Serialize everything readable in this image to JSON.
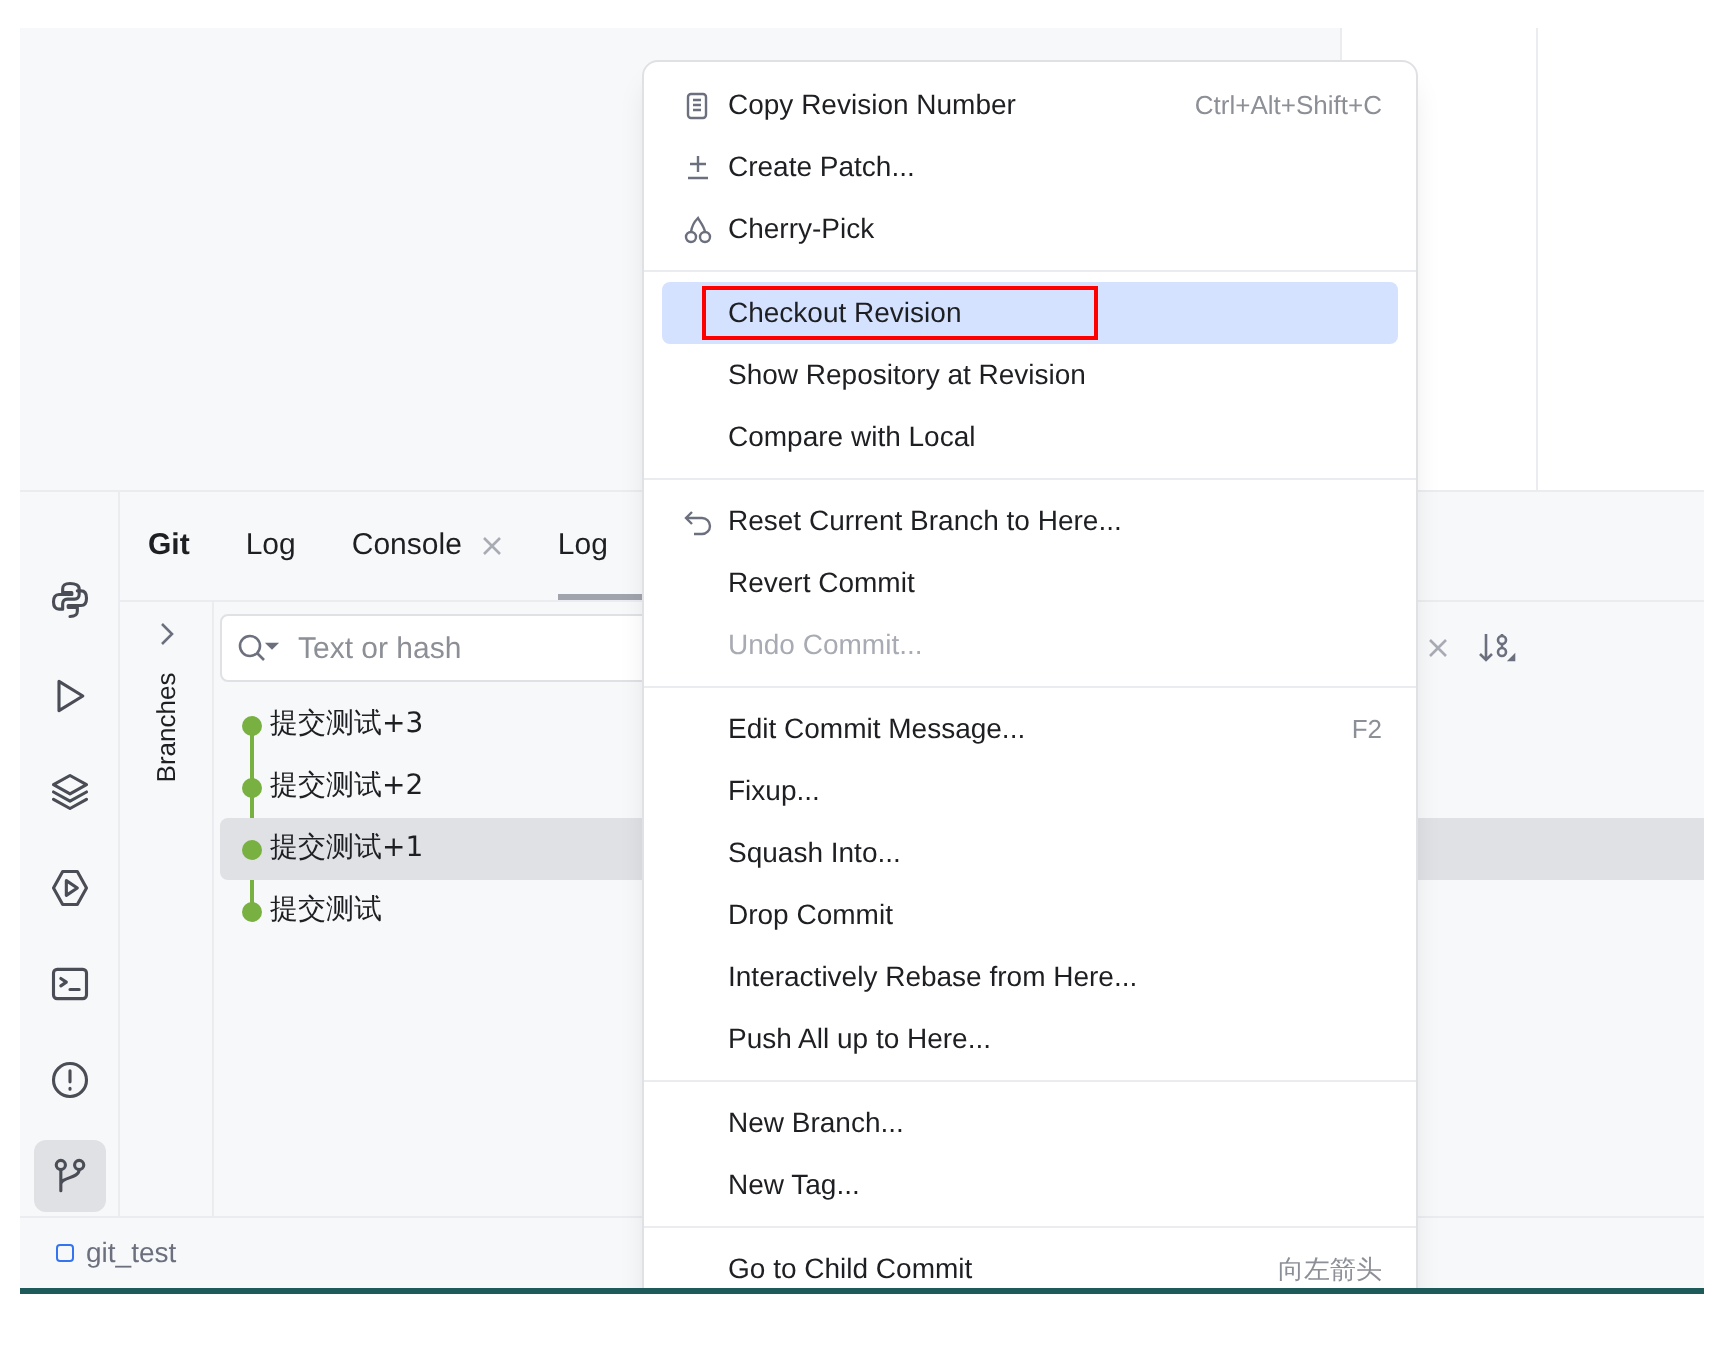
{
  "tool_windows": [
    {
      "kind": "python",
      "selected": false
    },
    {
      "kind": "run",
      "selected": false
    },
    {
      "kind": "layers",
      "selected": false
    },
    {
      "kind": "services",
      "selected": false
    },
    {
      "kind": "terminal",
      "selected": false
    },
    {
      "kind": "problems",
      "selected": false
    },
    {
      "kind": "git",
      "selected": true
    }
  ],
  "panel": {
    "title": "Git",
    "tabs": [
      {
        "label": "Log",
        "selected": false,
        "closable": false
      },
      {
        "label": "Console",
        "selected": false,
        "closable": true
      },
      {
        "label": "Log",
        "selected": true,
        "closable": false
      }
    ]
  },
  "branches_label": "Branches",
  "search": {
    "placeholder": "Text or hash"
  },
  "commits": [
    {
      "message": "提交测试+3",
      "selected": false
    },
    {
      "message": "提交测试+2",
      "selected": false
    },
    {
      "message": "提交测试+1",
      "selected": true
    },
    {
      "message": "提交测试",
      "selected": false
    }
  ],
  "status_bar": {
    "project": "git_test"
  },
  "context_menu": [
    [
      {
        "label": "Copy Revision Number",
        "shortcut": "Ctrl+Alt+Shift+C",
        "kind": "copy",
        "selected": false,
        "disabled": false,
        "outlined": false
      },
      {
        "label": "Create Patch...",
        "kind": "plusminus",
        "selected": false,
        "disabled": false,
        "outlined": false
      },
      {
        "label": "Cherry-Pick",
        "kind": "cherry",
        "selected": false,
        "disabled": false,
        "outlined": false
      }
    ],
    [
      {
        "label": "Checkout Revision",
        "selected": true,
        "disabled": false,
        "outlined": true
      },
      {
        "label": "Show Repository at Revision",
        "selected": false,
        "disabled": false,
        "outlined": false
      },
      {
        "label": "Compare with Local",
        "selected": false,
        "disabled": false,
        "outlined": false
      }
    ],
    [
      {
        "label": "Reset Current Branch to Here...",
        "kind": "undo",
        "selected": false,
        "disabled": false,
        "outlined": false
      },
      {
        "label": "Revert Commit",
        "selected": false,
        "disabled": false,
        "outlined": false
      },
      {
        "label": "Undo Commit...",
        "selected": false,
        "disabled": true,
        "outlined": false
      }
    ],
    [
      {
        "label": "Edit Commit Message...",
        "shortcut": "F2",
        "selected": false,
        "disabled": false,
        "outlined": false
      },
      {
        "label": "Fixup...",
        "selected": false,
        "disabled": false,
        "outlined": false
      },
      {
        "label": "Squash Into...",
        "selected": false,
        "disabled": false,
        "outlined": false
      },
      {
        "label": "Drop Commit",
        "selected": false,
        "disabled": false,
        "outlined": false
      },
      {
        "label": "Interactively Rebase from Here...",
        "selected": false,
        "disabled": false,
        "outlined": false
      },
      {
        "label": "Push All up to Here...",
        "selected": false,
        "disabled": false,
        "outlined": false
      }
    ],
    [
      {
        "label": "New Branch...",
        "selected": false,
        "disabled": false,
        "outlined": false
      },
      {
        "label": "New Tag...",
        "selected": false,
        "disabled": false,
        "outlined": false
      }
    ],
    [
      {
        "label": "Go to Child Commit",
        "shortcut": "向左箭头",
        "selected": false,
        "disabled": false,
        "outlined": false
      }
    ]
  ]
}
